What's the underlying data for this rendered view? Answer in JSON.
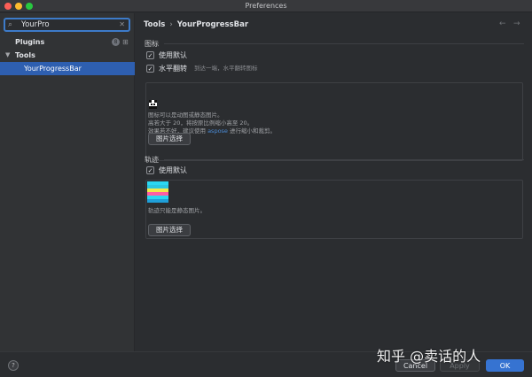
{
  "window": {
    "title": "Preferences"
  },
  "sidebar": {
    "search": {
      "value": "YourPro"
    },
    "items": [
      {
        "label": "Plugins",
        "badge": "8"
      },
      {
        "label": "Tools"
      },
      {
        "label": "YourProgressBar",
        "selected": true
      }
    ]
  },
  "header": {
    "breadcrumb": [
      "Tools",
      "YourProgressBar"
    ],
    "separator": "›"
  },
  "icon_section": {
    "title": "图标",
    "use_default_label": "使用默认",
    "flip_label": "水平翻转",
    "flip_hint": "到达一端，水平翻转图标",
    "desc_line1": "图标可以是动图或静态图片。",
    "desc_line2": "高若大于 20，将按原比例缩小高至 20。",
    "desc_line3a": "效果若不好，建议使用 ",
    "desc_link": "aspose",
    "desc_line3b": " 进行缩小和裁剪。",
    "button_label": "图片选择"
  },
  "track_section": {
    "title": "轨迹",
    "use_default_label": "使用默认",
    "desc": "轨迹只能是静态图片。",
    "button_label": "图片选择"
  },
  "footer": {
    "help": "?",
    "cancel": "Cancel",
    "apply": "Apply",
    "ok": "OK"
  },
  "watermark": "知乎 @卖话的人",
  "colors": {
    "accent": "#3673d1",
    "selection": "#2e5fb0",
    "link": "#4a8bd6"
  }
}
